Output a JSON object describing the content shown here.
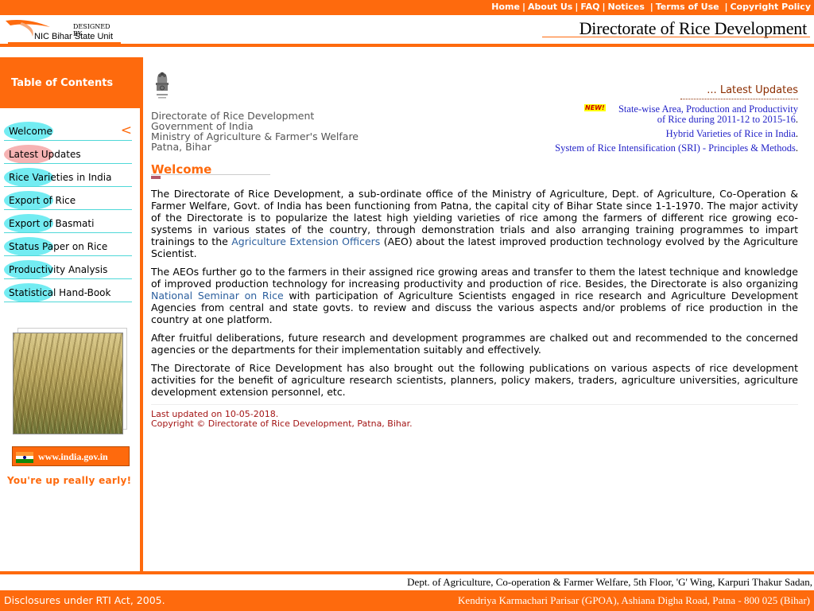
{
  "top_nav": {
    "links": [
      "Home",
      "About Us",
      "FAQ",
      "Notices",
      "Terms of Use",
      "Copyright Policy"
    ]
  },
  "header": {
    "nic_designed": "DESIGNED BY",
    "nic_unit": "NIC Bihar State Unit",
    "site_title": "Directorate of Rice Development"
  },
  "sidebar": {
    "toc_title": "Table of Contents",
    "items": [
      {
        "label": "Welcome",
        "active_marker": "<"
      },
      {
        "label": "Latest Updates"
      },
      {
        "label": "Rice Varieties in India"
      },
      {
        "label": "Export of Rice"
      },
      {
        "label": "Export of Basmati"
      },
      {
        "label": "Status Paper on Rice"
      },
      {
        "label": "Productivity Analysis"
      },
      {
        "label": "Statistical Hand-Book"
      }
    ],
    "india_link": "www.india.gov.in",
    "greeting": "You're up really early!"
  },
  "org": {
    "line1": "Directorate of Rice Development",
    "line2": "Government of India",
    "line3": "Ministry of Agriculture & Farmer's Welfare",
    "line4": "Patna, Bihar"
  },
  "updates": {
    "heading": "... Latest Updates",
    "new_badge": "NEW!",
    "item1_line1": "State-wise Area, Production and Productivity",
    "item1_line2": "of Rice during 2011-12 to 2015-16",
    "item2": "Hybrid Varieties of Rice in India",
    "item3": "System of Rice Intensification (SRI) - Principles & Methods",
    "dot": "."
  },
  "welcome": {
    "heading": "Welcome",
    "p1_a": "The Directorate of Rice Development, a sub-ordinate office of the Ministry of Agriculture, Dept. of Agriculture, Co-Operation & Farmer Welfare, Govt. of India has been functioning from Patna, the capital city of Bihar State since 1-1-1970. The major activity of the Directorate is to popularize the latest high yielding varieties of rice among the farmers of different rice growing eco-systems in various states of the country, through demonstration trials and also arranging training programmes to impart trainings to the ",
    "p1_link": "Agriculture Extension Officers",
    "p1_b": " (AEO) about the latest improved production technology evolved by the Agriculture Scientist.",
    "p2_a": "The  AEOs further go to the farmers in their assigned rice growing areas and transfer to them the latest technique and knowledge of improved production technology for increasing productivity and production of rice. Besides, the Directorate is also organizing ",
    "p2_link": "National Seminar on Rice",
    "p2_b": " with participation of Agriculture Scientists engaged in rice research and Agriculture Development Agencies from central and state govts. to review and discuss the various aspects and/or problems of rice production in the country at one platform.",
    "p3": "After fruitful deliberations, future research and development programmes are chalked out and recommended to the concerned agencies or the departments for their implementation suitably and effectively.",
    "p4": "The Directorate of Rice Development has also brought out the following publications on various aspects of rice development activities for the benefit of agriculture research scientists, planners, policy makers, traders, agriculture universities, agriculture development extension personnel, etc."
  },
  "meta": {
    "last_updated": "Last updated on 10-05-2018.",
    "copyright": "Copyright © Directorate of Rice Development, Patna, Bihar."
  },
  "footer": {
    "address_line1": "Dept. of Agriculture, Co-operation & Farmer Welfare, 5th Floor, 'G' Wing, Karpuri Thakur Sadan,",
    "rti": "Disclosures under RTI Act, 2005.",
    "address_line2": "Kendriya Karmachari Parisar (GPOA), Ashiana Digha Road, Patna - 800 025 (Bihar)"
  },
  "colors": {
    "accent": "#fe6a0d",
    "nav_bubble": "#73ecf2",
    "nav_bubble_hover": "#f6b3b3",
    "link_blue": "#2323c8"
  }
}
